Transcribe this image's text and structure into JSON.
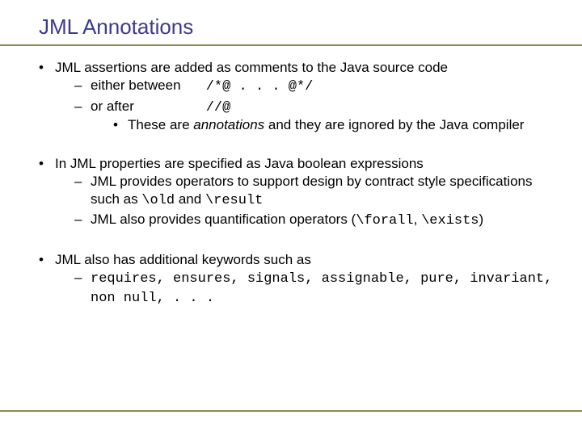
{
  "title": "JML Annotations",
  "bullets": {
    "b1": {
      "lead": "JML assertions are added as comments to the Java source code",
      "sub1_label": "either between",
      "sub1_code": "/*@ . . . @*/",
      "sub2_label": "or after",
      "sub2_code": "//@",
      "sub3_a": "These are ",
      "sub3_b": "annotations",
      "sub3_c": " and they are ignored by the Java compiler"
    },
    "b2": {
      "lead": "In JML properties are specified as Java boolean expressions",
      "sub1_a": "JML provides operators to support design by contract style specifications such as ",
      "sub1_code1": "\\old",
      "sub1_mid": " and ",
      "sub1_code2": "\\result",
      "sub2_a": "JML also provides quantification operators (",
      "sub2_code1": "\\forall",
      "sub2_mid": ", ",
      "sub2_code2": "\\exists",
      "sub2_end": ")"
    },
    "b3": {
      "lead": "JML also has additional keywords such as",
      "sub1_code": "requires, ensures, signals, assignable, pure, invariant, non null, . . ."
    }
  }
}
